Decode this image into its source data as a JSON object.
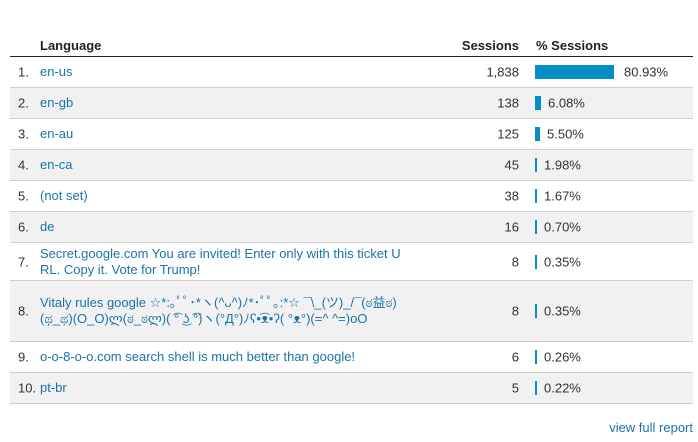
{
  "table": {
    "headers": {
      "language": "Language",
      "sessions": "Sessions",
      "percent_sessions": "% Sessions"
    },
    "rows": [
      {
        "rank": "1.",
        "language": "en-us",
        "sessions": "1,838",
        "percent": "80.93%",
        "share": 80.93
      },
      {
        "rank": "2.",
        "language": "en-gb",
        "sessions": "138",
        "percent": "6.08%",
        "share": 6.08
      },
      {
        "rank": "3.",
        "language": "en-au",
        "sessions": "125",
        "percent": "5.50%",
        "share": 5.5
      },
      {
        "rank": "4.",
        "language": "en-ca",
        "sessions": "45",
        "percent": "1.98%",
        "share": 1.98
      },
      {
        "rank": "5.",
        "language": "(not set)",
        "sessions": "38",
        "percent": "1.67%",
        "share": 1.67
      },
      {
        "rank": "6.",
        "language": "de",
        "sessions": "16",
        "percent": "0.70%",
        "share": 0.7
      },
      {
        "rank": "7.",
        "language": "Secret.google.com You are invited! Enter only with this ticket URL. Copy it. Vote for Trump!",
        "sessions": "8",
        "percent": "0.35%",
        "share": 0.35
      },
      {
        "rank": "8.",
        "language": "Vitaly rules google ☆*:｡ﾟﾟ･*ヽ(^ᴗ^)ﾉ*･ﾟﾟ｡:*☆ ¯\\_(ツ)_/¯(ಠ益ಠ)(ಥ_ಥ)(O_O)ლ(ಠ_ಠლ)( ͡° ͜ʖ ͡°)ヽ(°Д°)ﾉʕ•͡ᴥ•ʔ( °ᴥ°)(=^ ^=)oO",
        "sessions": "8",
        "percent": "0.35%",
        "share": 0.35
      },
      {
        "rank": "9.",
        "language": "o-o-8-o-o.com search shell is much better than google!",
        "sessions": "6",
        "percent": "0.26%",
        "share": 0.26
      },
      {
        "rank": "10.",
        "language": "pt-br",
        "sessions": "5",
        "percent": "0.22%",
        "share": 0.22
      }
    ]
  },
  "footer": {
    "link_label": "view full report"
  },
  "colors": {
    "bar": "#058dc7",
    "link": "#1a73a8",
    "row_alt": "#f1f1f1"
  }
}
